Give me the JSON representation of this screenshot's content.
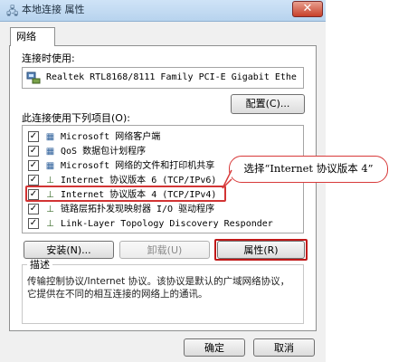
{
  "window": {
    "title": "本地连接 属性",
    "close_glyph": "✕",
    "title_icon": "network-icon"
  },
  "tabs": [
    {
      "label": "网络",
      "selected": true
    }
  ],
  "connection": {
    "label": "连接时使用:",
    "adapter": "Realtek RTL8168/8111 Family PCI-E Gigabit Ethe",
    "configure_button": "配置(C)..."
  },
  "items_label": "此连接使用下列项目(O):",
  "items": [
    {
      "label": "Microsoft 网络客户端",
      "checked": true,
      "icon": "network-client-icon"
    },
    {
      "label": "QoS 数据包计划程序",
      "checked": true,
      "icon": "qos-icon"
    },
    {
      "label": "Microsoft 网络的文件和打印机共享",
      "checked": true,
      "icon": "file-share-icon"
    },
    {
      "label": "Internet 协议版本 6 (TCP/IPv6)",
      "checked": true,
      "icon": "protocol-icon"
    },
    {
      "label": "Internet 协议版本 4 (TCP/IPv4)",
      "checked": true,
      "icon": "protocol-icon"
    },
    {
      "label": "链路层拓扑发现映射器 I/O 驱动程序",
      "checked": true,
      "icon": "protocol-icon"
    },
    {
      "label": "Link-Layer Topology Discovery Responder",
      "checked": true,
      "icon": "protocol-icon"
    }
  ],
  "buttons": {
    "install": "安装(N)...",
    "uninstall": "卸载(U)",
    "properties": "属性(R)"
  },
  "description": {
    "title": "描述",
    "text": "传输控制协议/Internet 协议。该协议是默认的广域网络协议，它提供在不同的相互连接的网络上的通讯。"
  },
  "footer": {
    "ok": "确定",
    "cancel": "取消"
  },
  "callout": {
    "text": "选择“Internet 协议版本 4”"
  },
  "colors": {
    "highlight": "#d23434",
    "titlebar": "#cfe3f7"
  }
}
